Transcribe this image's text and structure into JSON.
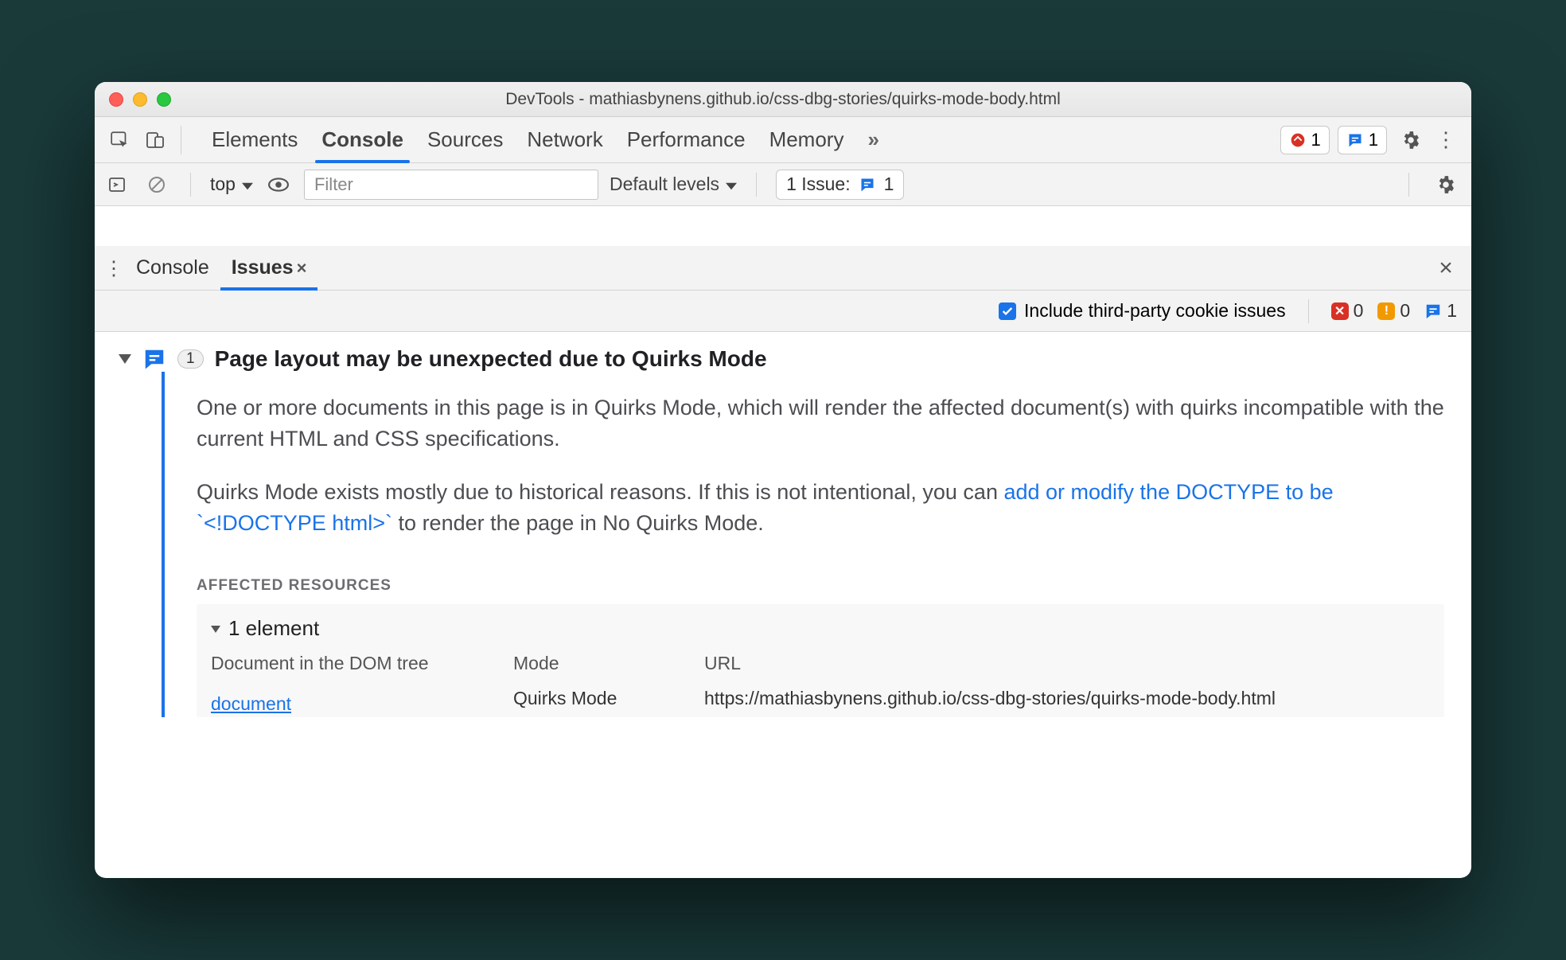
{
  "window": {
    "title": "DevTools - mathiasbynens.github.io/css-dbg-stories/quirks-mode-body.html"
  },
  "main_tabs": {
    "items": [
      "Elements",
      "Console",
      "Sources",
      "Network",
      "Performance",
      "Memory"
    ],
    "active": "Console",
    "errors": "1",
    "issues": "1"
  },
  "console_bar": {
    "context": "top",
    "filter_placeholder": "Filter",
    "levels": "Default levels",
    "issue_label": "1 Issue:",
    "issue_count": "1"
  },
  "drawer": {
    "tabs": [
      "Console",
      "Issues"
    ],
    "active": "Issues"
  },
  "issues_bar": {
    "checkbox_label": "Include third-party cookie issues",
    "errors": "0",
    "warnings": "0",
    "info": "1"
  },
  "issue": {
    "count": "1",
    "title": "Page layout may be unexpected due to Quirks Mode",
    "p1": "One or more documents in this page is in Quirks Mode, which will render the affected document(s) with quirks incompatible with the current HTML and CSS specifications.",
    "p2a": "Quirks Mode exists mostly due to historical reasons. If this is not intentional, you can ",
    "link": "add or modify the DOCTYPE to be `<!DOCTYPE html>`",
    "p2b": " to render the page in No Quirks Mode.",
    "affected_label": "AFFECTED RESOURCES",
    "elements_header": "1 element",
    "cols": {
      "c1": "Document in the DOM tree",
      "c2": "Mode",
      "c3": "URL"
    },
    "row": {
      "doc": "document",
      "mode": "Quirks Mode",
      "url": "https://mathiasbynens.github.io/css-dbg-stories/quirks-mode-body.html"
    }
  }
}
